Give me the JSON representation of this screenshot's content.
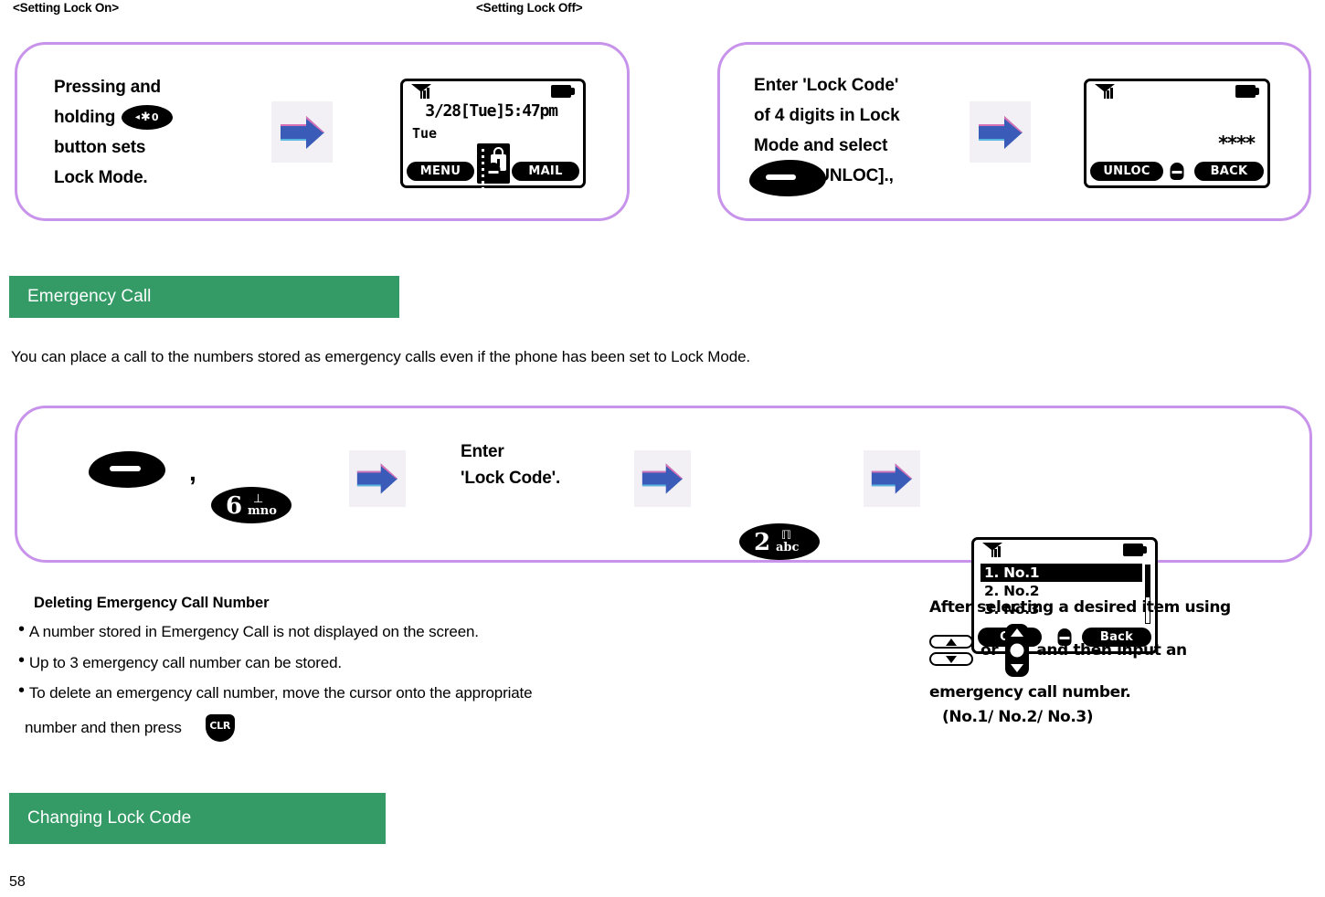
{
  "colors": {
    "panel_border": "#c893ea",
    "section_green": "#349a66",
    "arrow_blue": "#3a5cb8",
    "arrow_pink": "#d86fb4",
    "arrow_chip_bg": "#f2f0f4",
    "text": "#000000"
  },
  "top": {
    "caption_left": "<Setting Lock On>",
    "caption_right": "<Setting Lock Off>"
  },
  "lock_on_panel": {
    "step_text_lines": [
      "Pressing and",
      "holding",
      "button sets",
      "Lock Mode."
    ],
    "key_label": "*",
    "key_prefix_icon": "left-arrow-glyph",
    "key_suffix": "0",
    "arrow": "right-arrow-icon",
    "screen": {
      "signal_icon": "signal-bars-icon",
      "battery_icon": "battery-icon",
      "datetime": "3/28[Tue]5:47pm",
      "day": "Tue",
      "center_icon": "phone-lock-icon",
      "softkey_left": "MENU",
      "softkey_center": "center-select-key",
      "softkey_right": "MAIL"
    }
  },
  "lock_off_panel": {
    "step_text": "Enter 'Lock Code' of 4 digits in Lock Mode and select",
    "step_text_lines": [
      "Enter  'Lock  Code'",
      "of 4 digits in Lock",
      "Mode and select"
    ],
    "select_suffix": "[UNLOC].,",
    "soft_key_icon": "soft-select-key",
    "arrow": "right-arrow-icon",
    "screen": {
      "signal_icon": "signal-bars-icon",
      "battery_icon": "battery-icon",
      "code_mask": "****",
      "softkey_left": "UNLOC",
      "softkey_center": "center-select-key",
      "softkey_right": "BACK"
    }
  },
  "emergency_section": {
    "header": "Emergency Call",
    "intro": "You can place a call to the numbers stored as emergency calls even if the phone has been set to Lock Mode."
  },
  "emergency_flow": {
    "steps": [
      {
        "type": "key-soft",
        "name": "soft-select-key",
        "label": ""
      },
      {
        "type": "comma",
        "name": "comma-separator",
        "label": ","
      },
      {
        "type": "key-num",
        "name": "key-6",
        "digit": "6",
        "letters": "mno"
      },
      {
        "type": "arrow",
        "name": "right-arrow-icon",
        "label": ""
      },
      {
        "type": "text",
        "name": "enter-lock-code-label",
        "lines": [
          "Enter",
          "'Lock Code'."
        ]
      },
      {
        "type": "arrow",
        "name": "right-arrow-icon",
        "label": ""
      },
      {
        "type": "key-num",
        "name": "key-2",
        "digit": "2",
        "letters": "abc"
      },
      {
        "type": "arrow",
        "name": "right-arrow-icon",
        "label": ""
      }
    ],
    "screen": {
      "signal_icon": "signal-bars-icon",
      "battery_icon": "battery-icon",
      "list": [
        {
          "label": "1. No.1",
          "selected": true
        },
        {
          "label": "2. No.2",
          "selected": false
        },
        {
          "label": "3. No.3",
          "selected": false
        }
      ],
      "softkey_left": "OK",
      "softkey_center": "center-select-key",
      "softkey_right": "Back"
    }
  },
  "delete_notes": {
    "sub_head": "Deleting Emergency Call Number",
    "bullets": [
      "A number stored in Emergency Call is not displayed on the screen.",
      "Up to 3 emergency call number can be stored.",
      "To delete an emergency call number, move the cursor onto the appropriate"
    ],
    "bullet3_tail": "number and then press",
    "clr_key": "CLR"
  },
  "side_note": {
    "line1": "After selecting a desired item using",
    "or_word": "or",
    "line2_tail": "and then input an",
    "line3": "emergency call number.",
    "line4": "(No.1/ No.2/ No.3)",
    "nav_up_icon": "nav-up-icon",
    "nav_down_icon": "nav-down-icon",
    "nav_stick_icon": "nav-stick-icon"
  },
  "lock_code_section": {
    "header": "Changing Lock Code"
  },
  "footer": {
    "page_number": "58"
  }
}
